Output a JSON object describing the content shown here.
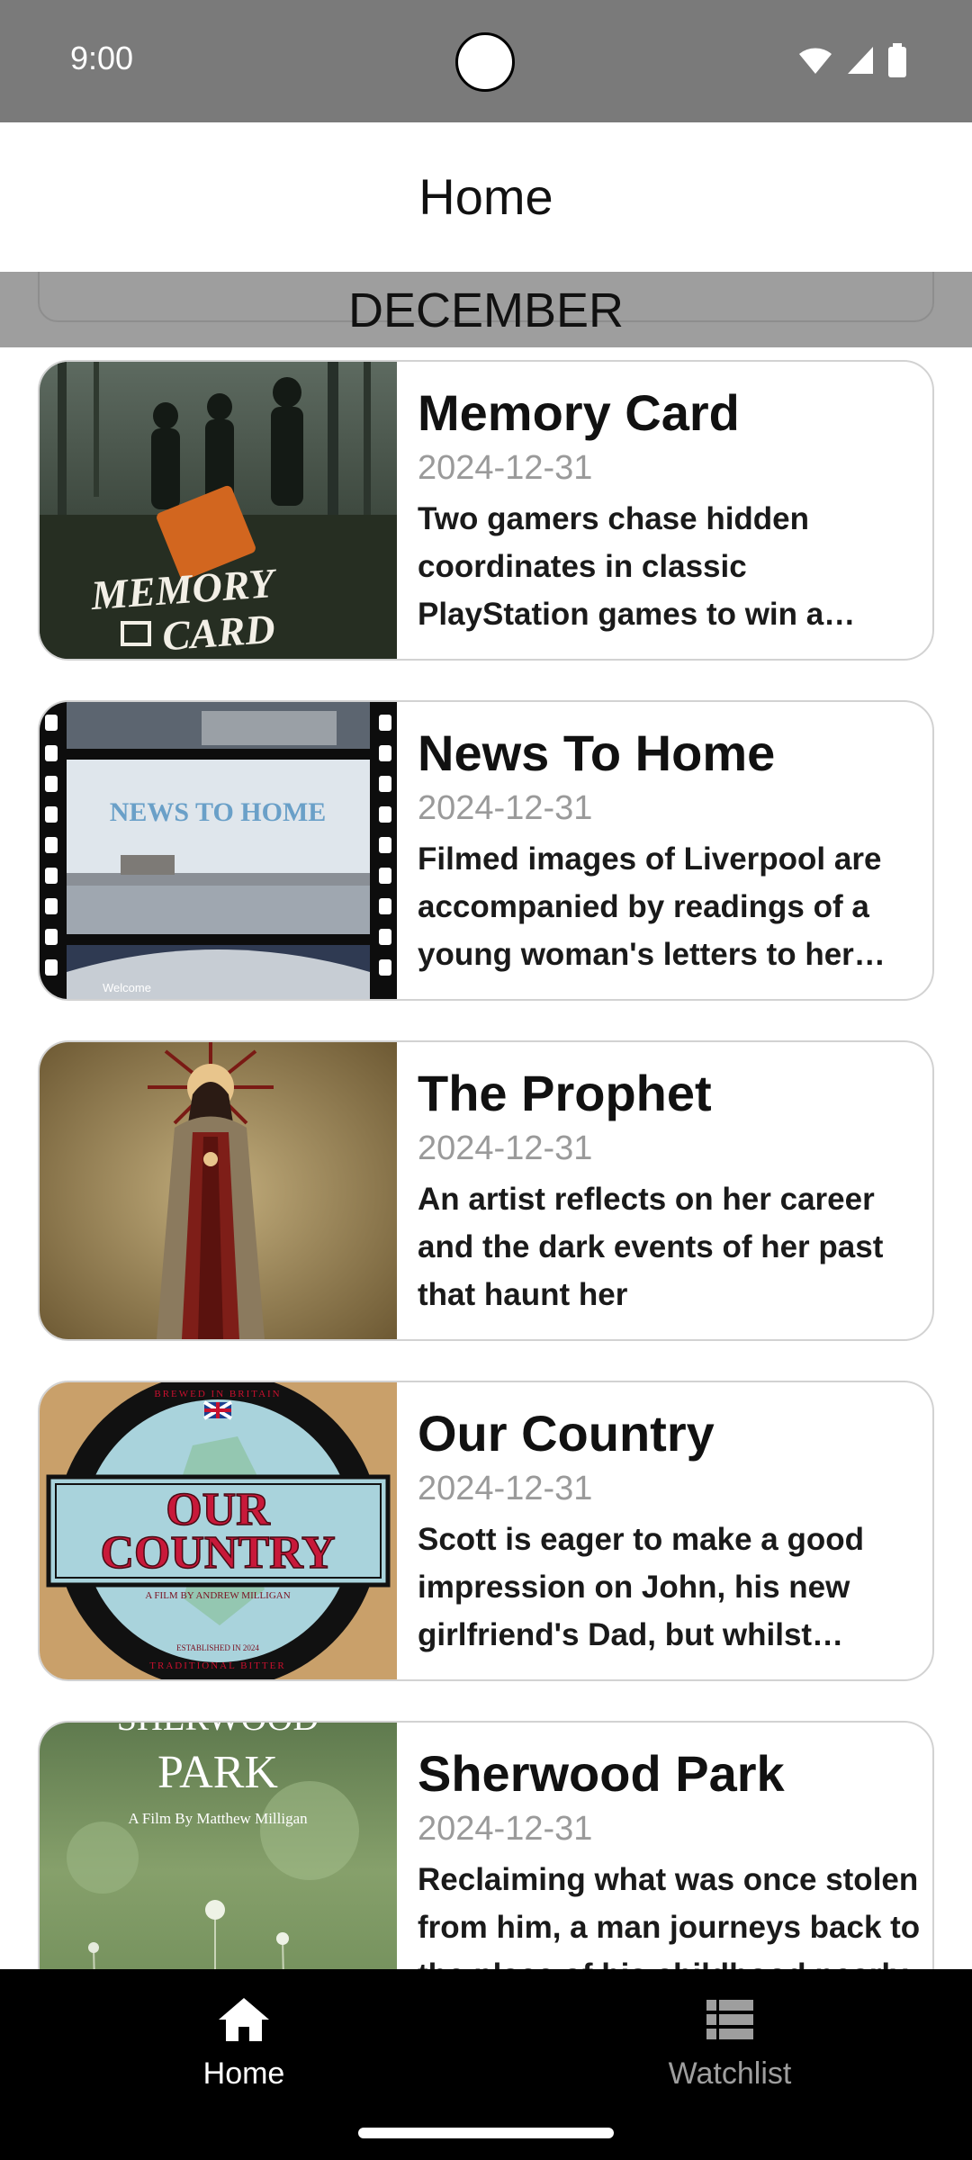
{
  "status_bar": {
    "time": "9:00"
  },
  "app_bar": {
    "title": "Home"
  },
  "section": {
    "month": "DECEMBER"
  },
  "movies": [
    {
      "title": "Memory Card",
      "date": "2024-12-31",
      "description": "Two gamers chase hidden coordinates in classic PlayStation games to win a valuable collectible",
      "poster_text": [
        "MEMORY",
        "CARD"
      ]
    },
    {
      "title": "News To Home",
      "date": "2024-12-31",
      "description": "Filmed images of Liverpool are accompanied by readings of a young woman's letters to her mother",
      "poster_text": [
        "NEWS TO HOME",
        "Welcome"
      ]
    },
    {
      "title": "The Prophet",
      "date": "2024-12-31",
      "description": "An artist reflects on her career and the dark events of her past that haunt her"
    },
    {
      "title": "Our Country",
      "date": "2024-12-31",
      "description": "Scott is eager to make a good impression on John, his new girlfriend's Dad, but whilst spending time together",
      "poster_text": [
        "BREWED IN BRITAIN",
        "OUR",
        "COUNTRY",
        "A FILM BY ANDREW MILLIGAN",
        "ESTABLISHED IN 2024",
        "TRADITIONAL BITTER"
      ]
    },
    {
      "title": "Sherwood Park",
      "date": "2024-12-31",
      "description": "Reclaiming what was once stolen from him, a man journeys back to the place of his childhood nearly",
      "poster_text": [
        "SHERWOOD",
        "PARK",
        "A Film By Matthew Milligan"
      ]
    }
  ],
  "bottom_nav": {
    "items": [
      {
        "label": "Home",
        "icon": "home-icon",
        "selected": true
      },
      {
        "label": "Watchlist",
        "icon": "list-icon",
        "selected": false
      }
    ]
  },
  "colors": {
    "status_bar": "#7a7a7a",
    "section_header": "#9e9e9e",
    "nav_background": "#000000",
    "nav_selected": "#ffffff",
    "nav_unselected": "#9e9e9e",
    "date_text": "#9a9a9a"
  }
}
